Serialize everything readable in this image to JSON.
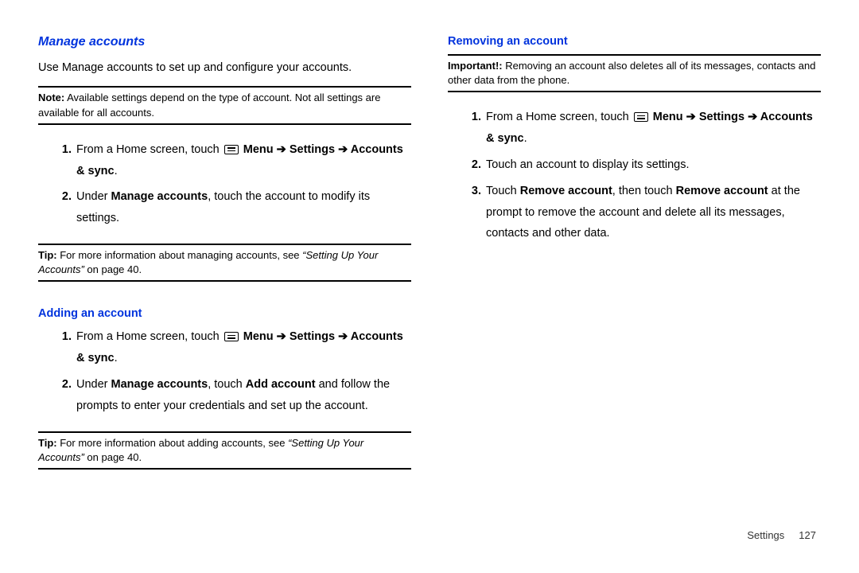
{
  "left": {
    "title": "Manage accounts",
    "intro": "Use Manage accounts to set up and configure your accounts.",
    "note_label": "Note:",
    "note_body": " Available settings depend on the type of account.  Not all settings are available for all accounts.",
    "step1_lead": "From a Home screen, touch ",
    "step1_menu": "Menu",
    "step1_arrow1": " ➔ ",
    "step1_settings": "Settings",
    "step1_arrow2": " ➔ ",
    "step1_accs": "Accounts & sync",
    "step1_period": ".",
    "step2_a": "Under ",
    "step2_b": "Manage accounts",
    "step2_c": ", touch the account to modify its settings.",
    "tip1_label": "Tip:",
    "tip1_body_a": " For more information about managing accounts, see ",
    "tip1_ital": "“Setting Up Your Accounts”",
    "tip1_body_b": " on page 40.",
    "sub_add": "Adding an account",
    "add1_lead": "From a Home screen, touch ",
    "add1_menu": "Menu",
    "add1_arrow1": " ➔ ",
    "add1_settings": "Settings",
    "add1_arrow2": " ➔ ",
    "add1_accs": "Accounts & sync",
    "add1_period": ".",
    "add2_a": "Under ",
    "add2_b": "Manage accounts",
    "add2_c": ", touch ",
    "add2_d": "Add account",
    "add2_e": " and follow the prompts to enter your credentials and set up the account.",
    "tip2_label": "Tip:",
    "tip2_body_a": " For more information about adding accounts, see ",
    "tip2_ital": "“Setting Up Your Accounts”",
    "tip2_body_b": " on page 40."
  },
  "right": {
    "sub_remove": "Removing an account",
    "imp_label": "Important!:",
    "imp_body": " Removing an account also deletes all of its messages, contacts and other data from the phone.",
    "r1_lead": "From a Home screen, touch ",
    "r1_menu": "Menu",
    "r1_arrow1": " ➔ ",
    "r1_settings": "Settings",
    "r1_arrow2": " ➔ ",
    "r1_accs": "Accounts & sync",
    "r1_period": ".",
    "r2": "Touch an account to display its settings.",
    "r3_a": "Touch ",
    "r3_b": "Remove account",
    "r3_c": ", then touch ",
    "r3_d": "Remove account",
    "r3_e": " at the prompt to remove the account and delete all its messages, contacts and other data."
  },
  "footer": {
    "chapter": "Settings",
    "page": "127"
  }
}
